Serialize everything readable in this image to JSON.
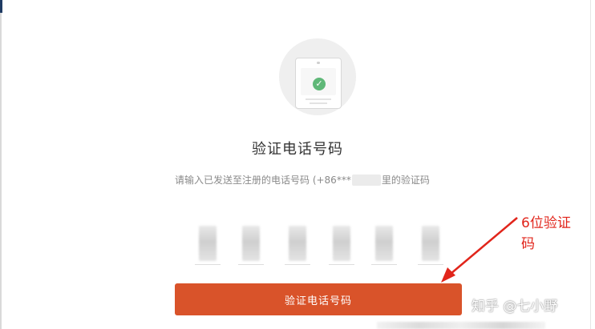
{
  "dialog": {
    "title": "验证电话号码",
    "subtitle_prefix": "请输入已发送至注册的电话号码 (+86***",
    "subtitle_suffix": "里的验证码",
    "code_length": 6,
    "verify_button_label": "验证电话号码"
  },
  "annotation": {
    "line1": "6位验证",
    "line2": "码",
    "color": "#e1251b"
  },
  "watermark": {
    "text": "知乎 @七小野"
  },
  "colors": {
    "accent_button": "#d9532a",
    "check_green": "#5fb878"
  },
  "icons": {
    "illustration": "phone-check-icon",
    "arrow": "red-arrow-icon"
  }
}
